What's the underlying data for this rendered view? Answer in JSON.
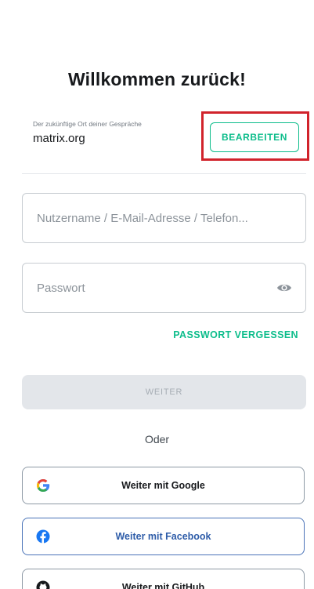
{
  "login": {
    "title": "Willkommen zurück!",
    "server": {
      "caption": "Der zukünftige Ort deiner Gespräche",
      "value": "matrix.org",
      "edit_label": "BEARBEITEN"
    },
    "username": {
      "placeholder": "Nutzername / E-Mail-Adresse / Telefon..."
    },
    "password": {
      "placeholder": "Passwort",
      "toggle_icon": "eye-icon"
    },
    "forgot_label": "PASSWORT VERGESSEN",
    "continue_label": "WEITER",
    "or_label": "Oder",
    "sso": [
      {
        "label": "Weiter mit Google",
        "icon": "google-icon"
      },
      {
        "label": "Weiter mit Facebook",
        "icon": "facebook-icon"
      },
      {
        "label": "Weiter mit GitHub",
        "icon": "github-icon"
      }
    ]
  },
  "colors": {
    "accent": "#0dbd8b",
    "highlight": "#d1232b",
    "disabled_bg": "#e3e6ea",
    "facebook": "#1877f2"
  }
}
